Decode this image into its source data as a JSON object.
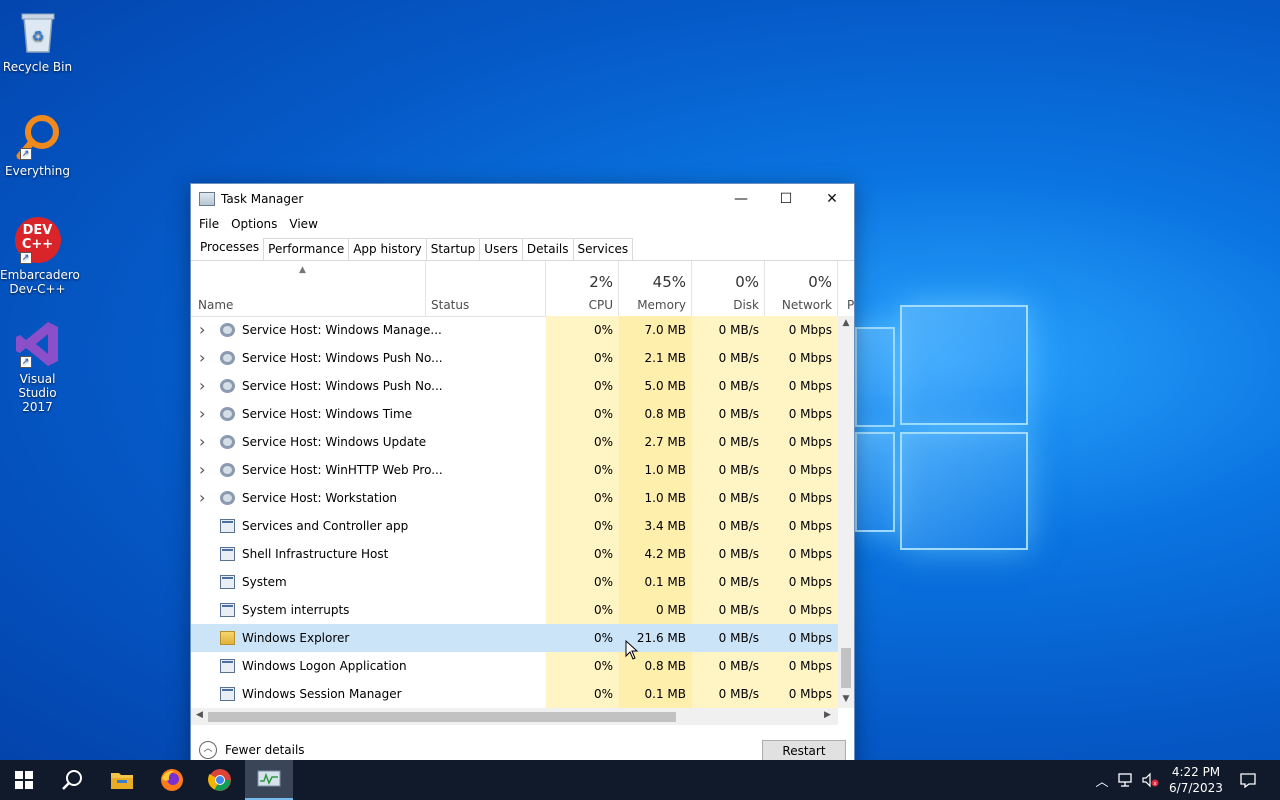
{
  "desktop": {
    "icons": [
      {
        "label_1": "Recycle Bin",
        "label_2": ""
      },
      {
        "label_1": "Everything",
        "label_2": ""
      },
      {
        "label_1": "Embarcadero",
        "label_2": "Dev-C++"
      },
      {
        "label_1": "Visual Studio",
        "label_2": "2017"
      }
    ],
    "devcpp_badge_1": "DEV",
    "devcpp_badge_2": "C++"
  },
  "window": {
    "title": "Task Manager",
    "icon": "task-manager-icon",
    "controls": {
      "minimize": "—",
      "maximize": "☐",
      "close": "✕"
    },
    "menu": [
      "File",
      "Options",
      "View"
    ],
    "tabs": [
      "Processes",
      "Performance",
      "App history",
      "Startup",
      "Users",
      "Details",
      "Services"
    ],
    "active_tab": "Processes",
    "columns": {
      "name": "Name",
      "status": "Status",
      "cpu": {
        "label": "CPU",
        "pct": "2%"
      },
      "memory": {
        "label": "Memory",
        "pct": "45%"
      },
      "disk": {
        "label": "Disk",
        "pct": "0%"
      },
      "network": {
        "label": "Network",
        "pct": "0%"
      },
      "power": "P"
    },
    "processes": [
      {
        "name": "Service Host: Windows Manage...",
        "expandable": true,
        "icon": "gear-icon",
        "cpu": "0%",
        "memory": "7.0 MB",
        "disk": "0 MB/s",
        "network": "0 Mbps"
      },
      {
        "name": "Service Host: Windows Push No...",
        "expandable": true,
        "icon": "gear-icon",
        "cpu": "0%",
        "memory": "2.1 MB",
        "disk": "0 MB/s",
        "network": "0 Mbps"
      },
      {
        "name": "Service Host: Windows Push No...",
        "expandable": true,
        "icon": "gear-icon",
        "cpu": "0%",
        "memory": "5.0 MB",
        "disk": "0 MB/s",
        "network": "0 Mbps"
      },
      {
        "name": "Service Host: Windows Time",
        "expandable": true,
        "icon": "gear-icon",
        "cpu": "0%",
        "memory": "0.8 MB",
        "disk": "0 MB/s",
        "network": "0 Mbps"
      },
      {
        "name": "Service Host: Windows Update",
        "expandable": true,
        "icon": "gear-icon",
        "cpu": "0%",
        "memory": "2.7 MB",
        "disk": "0 MB/s",
        "network": "0 Mbps"
      },
      {
        "name": "Service Host: WinHTTP Web Pro...",
        "expandable": true,
        "icon": "gear-icon",
        "cpu": "0%",
        "memory": "1.0 MB",
        "disk": "0 MB/s",
        "network": "0 Mbps"
      },
      {
        "name": "Service Host: Workstation",
        "expandable": true,
        "icon": "gear-icon",
        "cpu": "0%",
        "memory": "1.0 MB",
        "disk": "0 MB/s",
        "network": "0 Mbps"
      },
      {
        "name": "Services and Controller app",
        "expandable": false,
        "icon": "window-app-icon",
        "cpu": "0%",
        "memory": "3.4 MB",
        "disk": "0 MB/s",
        "network": "0 Mbps"
      },
      {
        "name": "Shell Infrastructure Host",
        "expandable": false,
        "icon": "window-app-icon",
        "cpu": "0%",
        "memory": "4.2 MB",
        "disk": "0 MB/s",
        "network": "0 Mbps"
      },
      {
        "name": "System",
        "expandable": false,
        "icon": "window-app-icon",
        "cpu": "0%",
        "memory": "0.1 MB",
        "disk": "0 MB/s",
        "network": "0 Mbps"
      },
      {
        "name": "System interrupts",
        "expandable": false,
        "icon": "window-app-icon",
        "cpu": "0%",
        "memory": "0 MB",
        "disk": "0 MB/s",
        "network": "0 Mbps"
      },
      {
        "name": "Windows Explorer",
        "expandable": false,
        "icon": "folder-icon",
        "selected": true,
        "cpu": "0%",
        "memory": "21.6 MB",
        "disk": "0 MB/s",
        "network": "0 Mbps"
      },
      {
        "name": "Windows Logon Application",
        "expandable": false,
        "icon": "window-app-icon",
        "cpu": "0%",
        "memory": "0.8 MB",
        "disk": "0 MB/s",
        "network": "0 Mbps"
      },
      {
        "name": "Windows Session Manager",
        "expandable": false,
        "icon": "window-app-icon",
        "cpu": "0%",
        "memory": "0.1 MB",
        "disk": "0 MB/s",
        "network": "0 Mbps"
      }
    ],
    "footer": {
      "fewer_details": "Fewer details",
      "restart": "Restart"
    }
  },
  "taskbar": {
    "items": [
      "start-icon",
      "search-icon",
      "file-explorer-icon",
      "firefox-icon",
      "chrome-icon",
      "task-manager-icon"
    ],
    "clock_time": "4:22 PM",
    "clock_date": "6/7/2023",
    "tray": [
      "chevron-up-icon",
      "network-icon",
      "volume-muted-icon",
      "notification-icon"
    ]
  }
}
